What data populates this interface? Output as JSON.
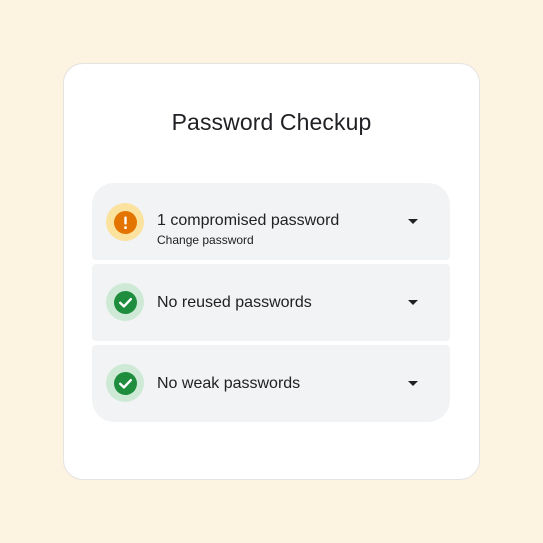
{
  "title": "Password Checkup",
  "colors": {
    "background": "#FDF3E1",
    "warning_halo": "#FBE29E",
    "warning": "#E37400",
    "ok_halo": "#CEEAD6",
    "ok": "#1E8E3E"
  },
  "items": [
    {
      "icon": "warning-icon",
      "label": "1 compromised password",
      "sublabel": "Change password"
    },
    {
      "icon": "check-icon",
      "label": "No reused passwords"
    },
    {
      "icon": "check-icon",
      "label": "No weak passwords"
    }
  ]
}
